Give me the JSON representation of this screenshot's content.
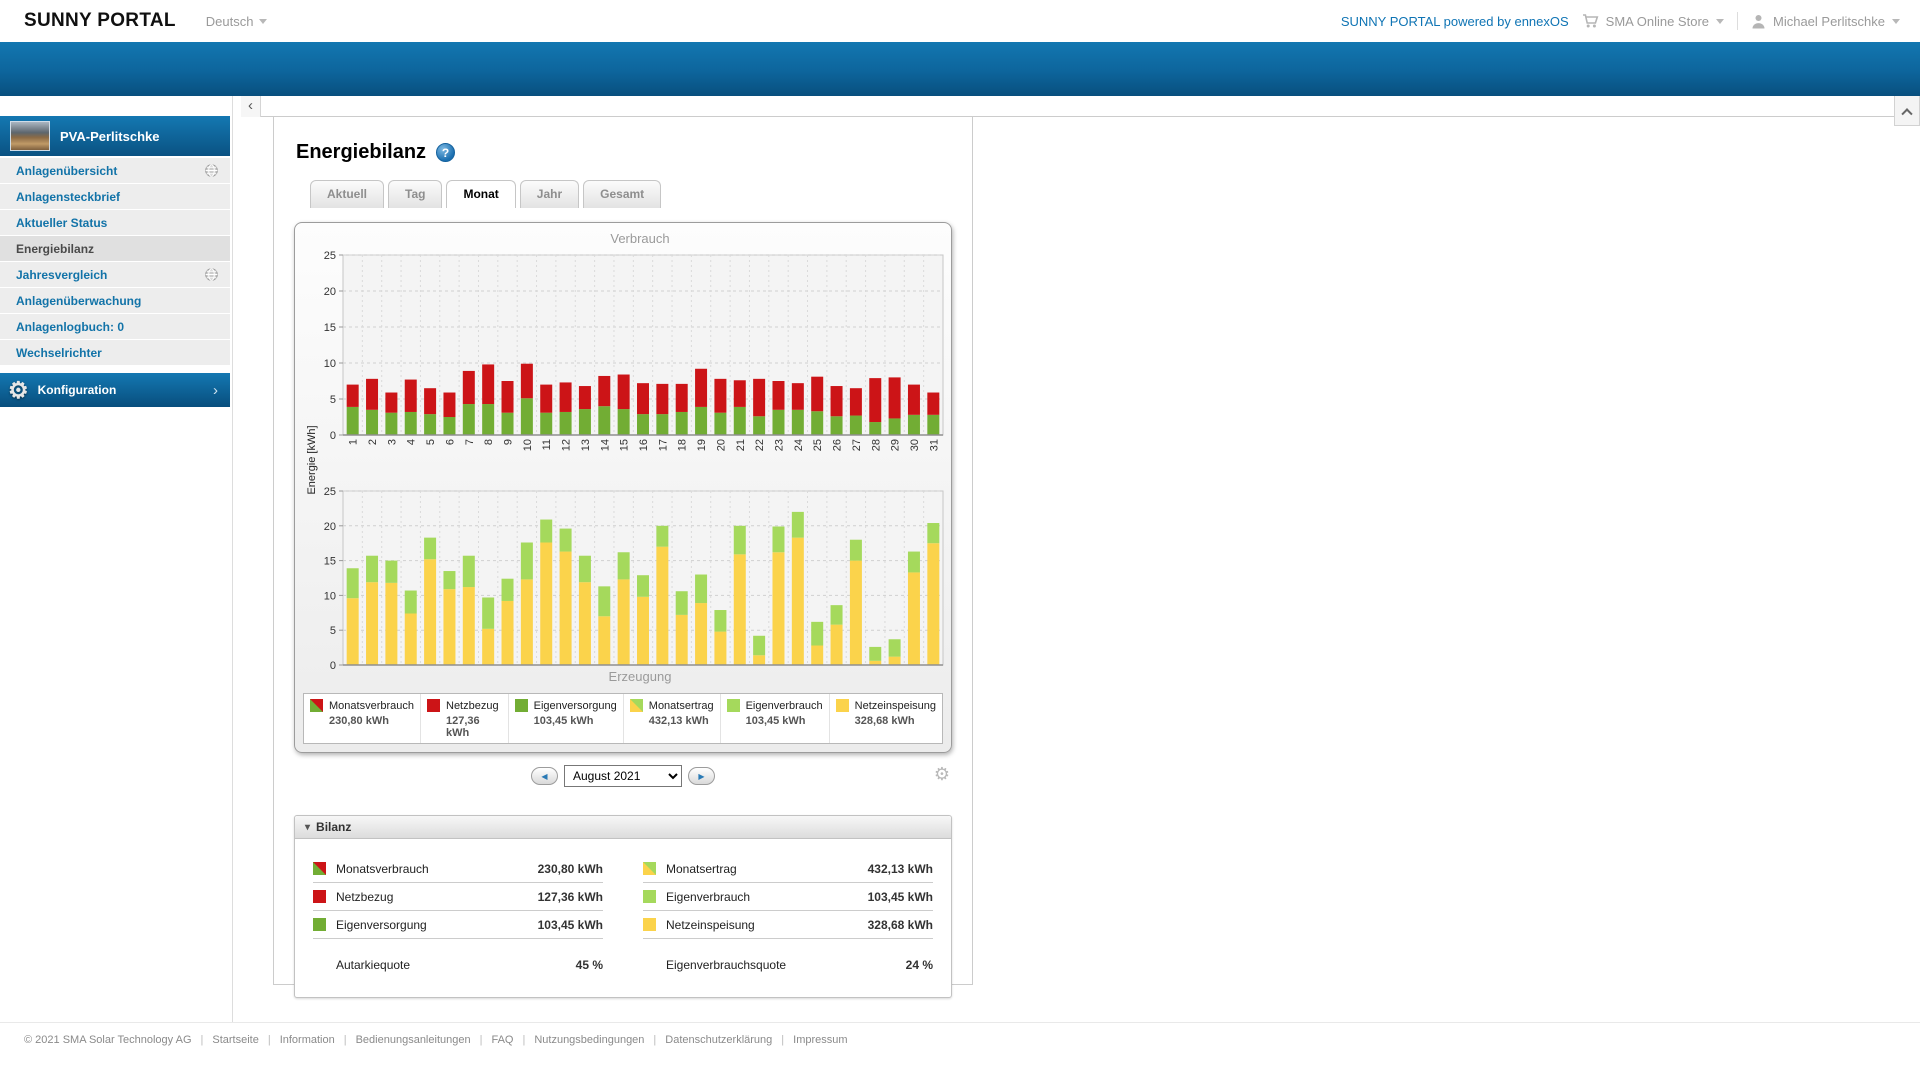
{
  "topbar": {
    "logo": "SUNNY PORTAL",
    "language": "Deutsch",
    "powered": "SUNNY PORTAL powered by ennexOS",
    "store": "SMA Online Store",
    "user": "Michael Perlitschke"
  },
  "sidebar": {
    "plant_name": "PVA-Perlitschke",
    "items": [
      {
        "label": "Anlagenübersicht",
        "globe": true,
        "active": false
      },
      {
        "label": "Anlagensteckbrief",
        "globe": false,
        "active": false
      },
      {
        "label": "Aktueller Status",
        "globe": false,
        "active": false
      },
      {
        "label": "Energiebilanz",
        "globe": false,
        "active": true
      },
      {
        "label": "Jahresvergleich",
        "globe": true,
        "active": false
      },
      {
        "label": "Anlagenüberwachung",
        "globe": false,
        "active": false
      },
      {
        "label": "Anlagenlogbuch: 0",
        "globe": false,
        "active": false
      },
      {
        "label": "Wechselrichter",
        "globe": false,
        "active": false
      }
    ],
    "config_label": "Konfiguration"
  },
  "page": {
    "title": "Energiebilanz",
    "tabs": [
      "Aktuell",
      "Tag",
      "Monat",
      "Jahr",
      "Gesamt"
    ],
    "active_tab": "Monat"
  },
  "chart_data": [
    {
      "type": "bar",
      "stacked": true,
      "title": "Verbrauch",
      "ylabel": "Energie [kWh]",
      "ylim": [
        0,
        25
      ],
      "ytick_step": 5,
      "x": [
        1,
        2,
        3,
        4,
        5,
        6,
        7,
        8,
        9,
        10,
        11,
        12,
        13,
        14,
        15,
        16,
        17,
        18,
        19,
        20,
        21,
        22,
        23,
        24,
        25,
        26,
        27,
        28,
        29,
        30,
        31
      ],
      "series": [
        {
          "name": "Eigenversorgung",
          "color": "#72ad34",
          "values": [
            3.9,
            3.5,
            3.1,
            3.2,
            2.9,
            2.5,
            4.3,
            4.3,
            3.1,
            5.1,
            3.1,
            3.2,
            3.6,
            4.0,
            3.6,
            2.9,
            2.9,
            3.2,
            3.9,
            3.1,
            3.9,
            2.6,
            3.5,
            3.5,
            3.3,
            2.6,
            2.7,
            1.8,
            2.3,
            2.8,
            2.8
          ]
        },
        {
          "name": "Netzbezug",
          "color": "#cc1417",
          "values": [
            3.1,
            4.3,
            2.8,
            4.5,
            3.6,
            3.4,
            4.6,
            5.5,
            4.4,
            4.8,
            3.9,
            4.1,
            3.2,
            4.2,
            4.8,
            4.3,
            4.2,
            3.9,
            5.3,
            4.7,
            3.7,
            5.2,
            4.0,
            3.7,
            4.8,
            4.2,
            3.8,
            6.1,
            5.7,
            4.2,
            3.1
          ]
        }
      ]
    },
    {
      "type": "bar",
      "stacked": true,
      "title": "Erzeugung",
      "ylabel": "Energie [kWh]",
      "ylim": [
        0,
        25
      ],
      "ytick_step": 5,
      "x": [
        1,
        2,
        3,
        4,
        5,
        6,
        7,
        8,
        9,
        10,
        11,
        12,
        13,
        14,
        15,
        16,
        17,
        18,
        19,
        20,
        21,
        22,
        23,
        24,
        25,
        26,
        27,
        28,
        29,
        30,
        31
      ],
      "series": [
        {
          "name": "Netzeinspeisung",
          "color": "#fbd34b",
          "values": [
            9.6,
            11.9,
            11.8,
            7.4,
            15.2,
            10.9,
            11.2,
            5.2,
            9.2,
            12.3,
            17.6,
            16.3,
            11.9,
            7.0,
            12.3,
            9.8,
            17.0,
            7.2,
            8.9,
            4.8,
            15.9,
            1.4,
            16.2,
            18.3,
            2.8,
            5.8,
            15.0,
            0.6,
            1.2,
            13.3,
            17.5
          ]
        },
        {
          "name": "Eigenverbrauch",
          "color": "#a5d95c",
          "values": [
            4.3,
            3.8,
            3.2,
            3.3,
            3.1,
            2.6,
            4.5,
            4.5,
            3.2,
            5.3,
            3.3,
            3.3,
            3.8,
            4.3,
            3.9,
            3.1,
            3.0,
            3.4,
            4.1,
            3.1,
            4.1,
            2.8,
            3.7,
            3.7,
            3.4,
            2.8,
            3.0,
            2.0,
            2.5,
            3.0,
            2.9
          ]
        }
      ]
    }
  ],
  "legend": [
    {
      "icon": "red-green-split",
      "label": "Monatsverbrauch",
      "value": "230,80 kWh"
    },
    {
      "icon": "red",
      "label": "Netzbezug",
      "value": "127,36 kWh"
    },
    {
      "icon": "dark-green",
      "label": "Eigenversorgung",
      "value": "103,45 kWh"
    },
    {
      "icon": "green-yellow-split",
      "label": "Monatsertrag",
      "value": "432,13 kWh"
    },
    {
      "icon": "light-green",
      "label": "Eigenverbrauch",
      "value": "103,45 kWh"
    },
    {
      "icon": "yellow",
      "label": "Netzeinspeisung",
      "value": "328,68 kWh"
    }
  ],
  "date_selector": {
    "value": "August 2021"
  },
  "bilanz": {
    "title": "Bilanz",
    "left_rows": [
      {
        "icon": "red-green-split",
        "label": "Monatsverbrauch",
        "value": "230,80 kWh"
      },
      {
        "icon": "red",
        "label": "Netzbezug",
        "value": "127,36 kWh"
      },
      {
        "icon": "dark-green",
        "label": "Eigenversorgung",
        "value": "103,45 kWh"
      }
    ],
    "left_summary": {
      "label": "Autarkiequote",
      "value": "45 %"
    },
    "right_rows": [
      {
        "icon": "green-yellow-split",
        "label": "Monatsertrag",
        "value": "432,13 kWh"
      },
      {
        "icon": "light-green",
        "label": "Eigenverbrauch",
        "value": "103,45 kWh"
      },
      {
        "icon": "yellow",
        "label": "Netzeinspeisung",
        "value": "328,68 kWh"
      }
    ],
    "right_summary": {
      "label": "Eigenverbrauchsquote",
      "value": "24 %"
    }
  },
  "footer": {
    "copyright": "© 2021 SMA Solar Technology AG",
    "links": [
      "Startseite",
      "Information",
      "Bedienungsanleitungen",
      "FAQ",
      "Nutzungsbedingungen",
      "Datenschutzerklärung",
      "Impressum"
    ]
  },
  "colors": {
    "accent_blue": "#0f6fae",
    "red": "#cc1417",
    "dark_green": "#72ad34",
    "light_green": "#a5d95c",
    "yellow": "#fbd34b"
  }
}
